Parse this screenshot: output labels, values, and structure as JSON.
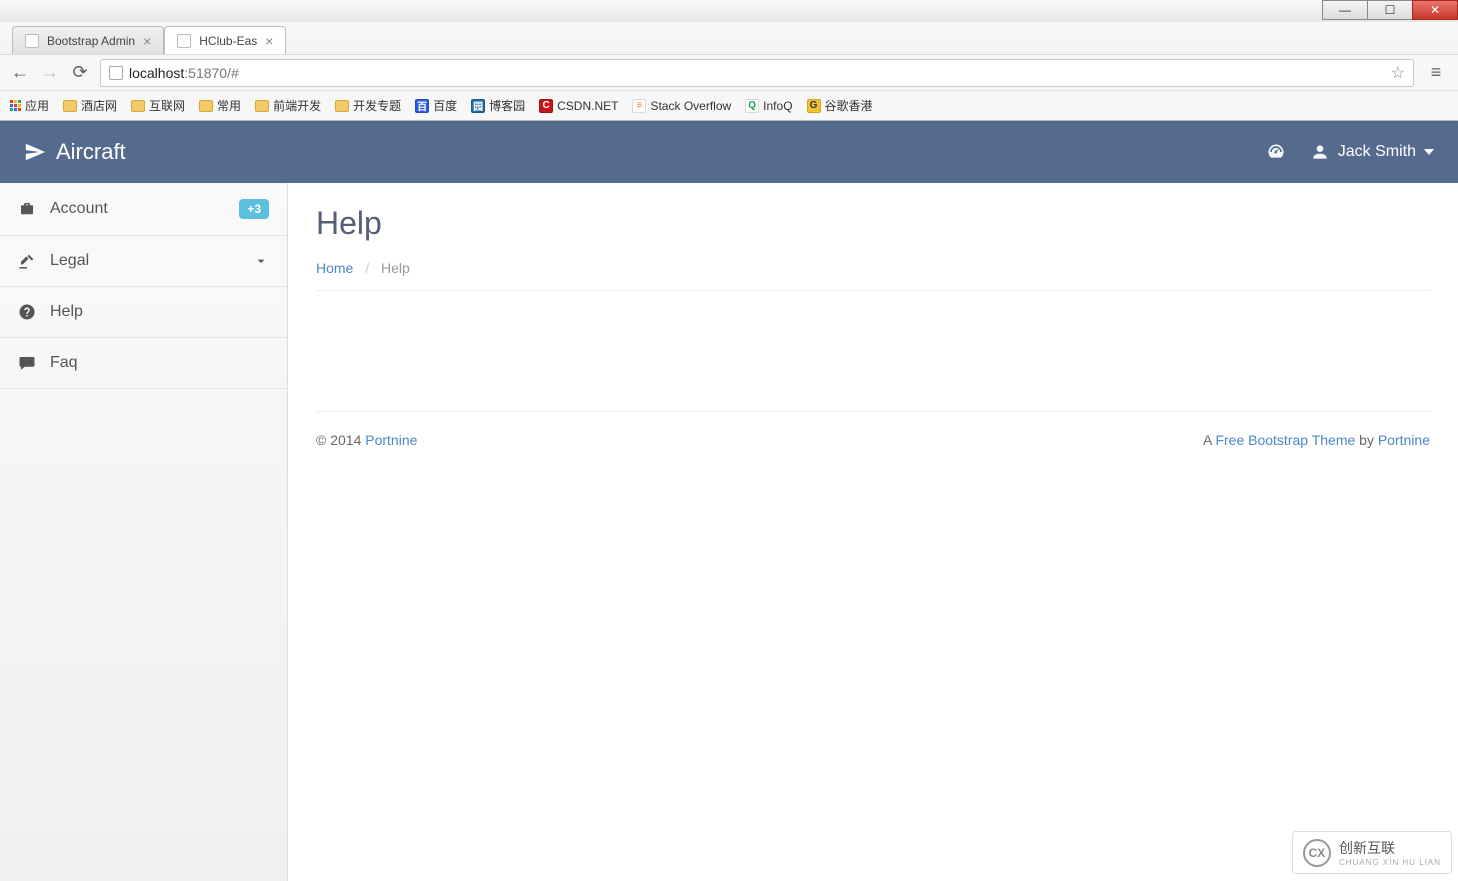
{
  "browser": {
    "tabs": [
      {
        "title": "Bootstrap Admin",
        "active": false
      },
      {
        "title": "HClub-Eas",
        "active": true
      }
    ],
    "address_host": "localhost",
    "address_path": ":51870/#",
    "bookmarks": [
      {
        "label": "应用",
        "type": "apps"
      },
      {
        "label": "酒店网",
        "type": "folder"
      },
      {
        "label": "互联网",
        "type": "folder"
      },
      {
        "label": "常用",
        "type": "folder"
      },
      {
        "label": "前端开发",
        "type": "folder"
      },
      {
        "label": "开发专题",
        "type": "folder"
      },
      {
        "label": "百度",
        "type": "icon",
        "bg": "#2b5dd9",
        "fg": "#fff",
        "ch": "百"
      },
      {
        "label": "博客园",
        "type": "icon",
        "bg": "#1f6aa6",
        "fg": "#fff",
        "ch": "园"
      },
      {
        "label": "CSDN.NET",
        "type": "icon",
        "bg": "#c5151b",
        "fg": "#fff",
        "ch": "C"
      },
      {
        "label": "Stack Overflow",
        "type": "icon",
        "bg": "#fff",
        "fg": "#f48024",
        "ch": "≡"
      },
      {
        "label": "InfoQ",
        "type": "icon",
        "bg": "#fff",
        "fg": "#15a34a",
        "ch": "Q"
      },
      {
        "label": "谷歌香港",
        "type": "icon",
        "bg": "#f1c232",
        "fg": "#333",
        "ch": "G"
      }
    ]
  },
  "navbar": {
    "brand": "Aircraft",
    "user": "Jack Smith"
  },
  "sidebar": {
    "items": [
      {
        "label": "Account",
        "icon": "briefcase",
        "badge": "+3"
      },
      {
        "label": "Legal",
        "icon": "gavel",
        "expandable": true
      },
      {
        "label": "Help",
        "icon": "help"
      },
      {
        "label": "Faq",
        "icon": "comment"
      }
    ]
  },
  "page": {
    "title": "Help",
    "breadcrumb_home": "Home",
    "breadcrumb_current": "Help"
  },
  "footer": {
    "copyright_prefix": "© 2014 ",
    "copyright_link": "Portnine",
    "right_prefix": "A ",
    "right_link1": "Free Bootstrap Theme",
    "right_mid": " by ",
    "right_link2": "Portnine"
  },
  "watermark": {
    "text": "创新互联",
    "sub": "CHUANG XIN HU LIAN"
  }
}
